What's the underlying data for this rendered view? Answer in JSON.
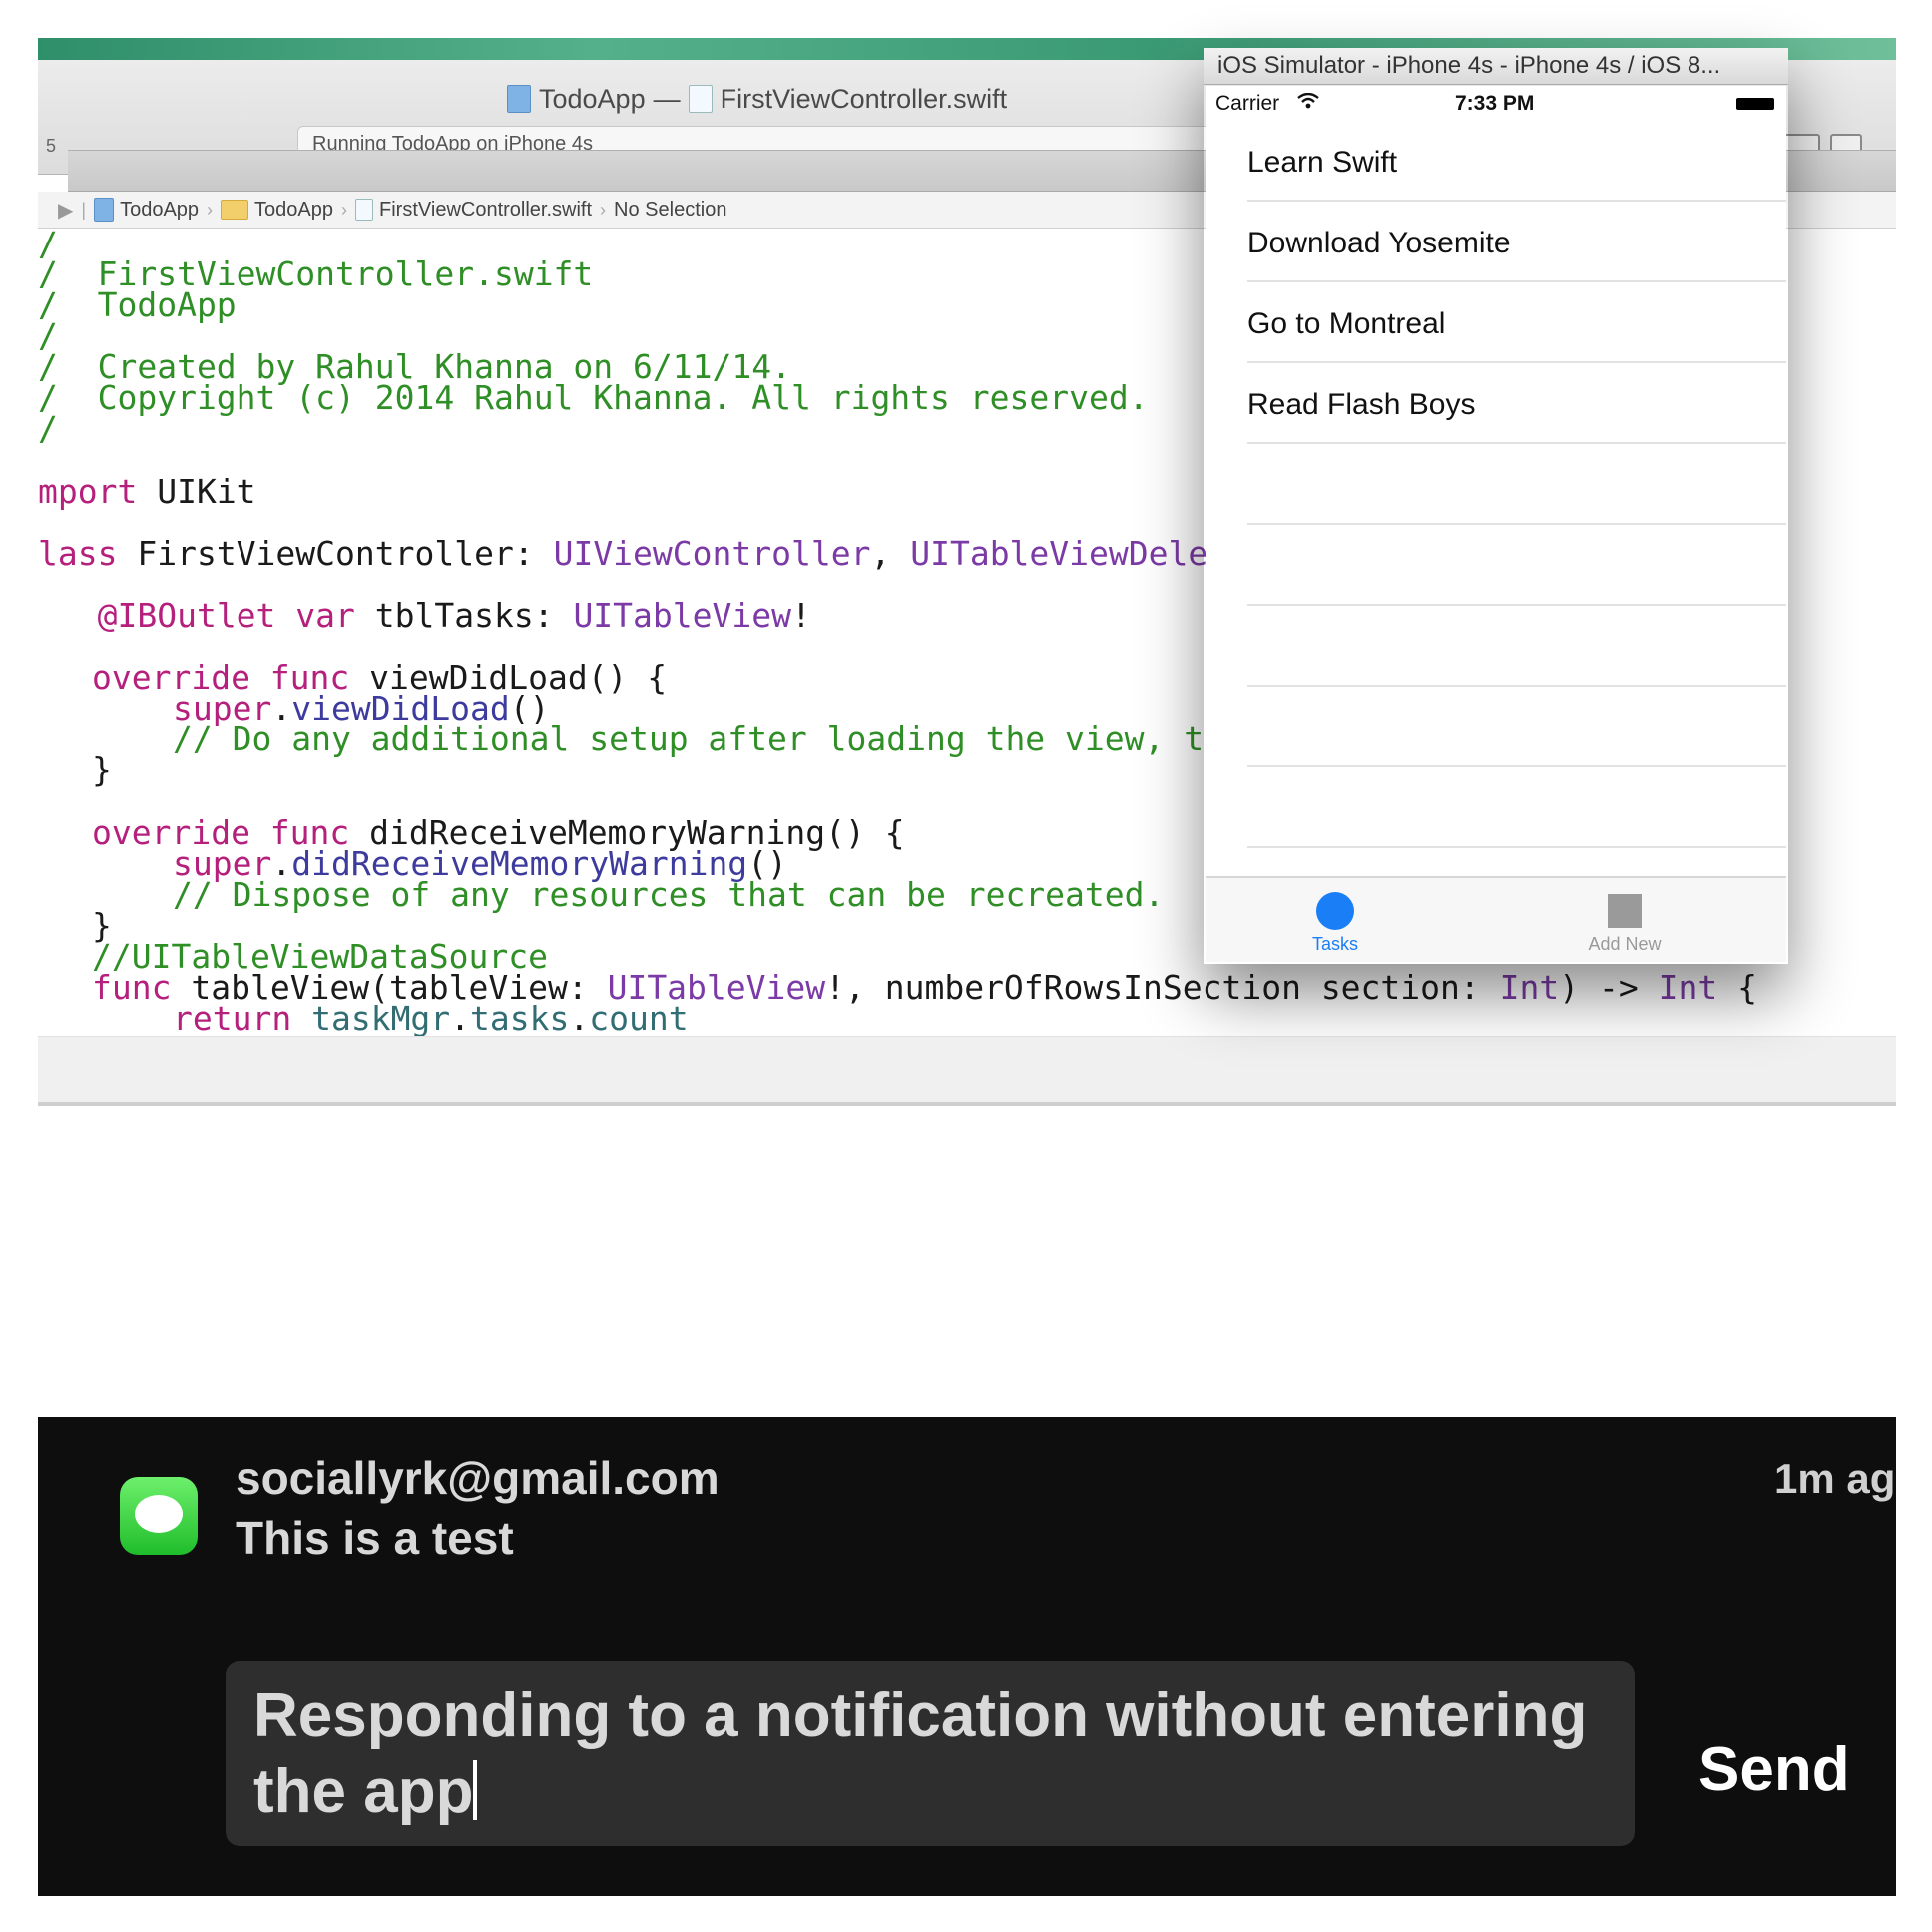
{
  "xcode": {
    "title_project": "TodoApp",
    "title_separator": "—",
    "title_file": "FirstViewController.swift",
    "status": "Running TodoApp on iPhone 4s",
    "toolbar_number": "5",
    "jumpbar": {
      "items": [
        "TodoApp",
        "TodoApp",
        "FirstViewController.swift",
        "No Selection"
      ]
    },
    "code": {
      "l1": "/",
      "l2": "/  FirstViewController.swift",
      "l3": "/  TodoApp",
      "l4": "/",
      "l5": "/  Created by Rahul Khanna on 6/11/14.",
      "l6": "/  Copyright (c) 2014 Rahul Khanna. All rights reserved.",
      "l7": "/",
      "l8_kw": "mport",
      "l8_rest": " UIKit",
      "l9_kw": "lass",
      "l9_mid": " FirstViewController: ",
      "l9_t1": "UIViewController",
      "l9_comma": ", ",
      "l9_t2": "UITableViewDele",
      "l10_indent": "   ",
      "l10_kw": "@IBOutlet var",
      "l10_mid": " tblTasks: ",
      "l10_t": "UITableView",
      "l10_end": "!",
      "l11_kw": "override func",
      "l11_rest": " viewDidLoad() {",
      "l12_kw": "super",
      "l12_dot": ".",
      "l12_fn": "viewDidLoad",
      "l12_end": "()",
      "l13": "// Do any additional setup after loading the view, t",
      "l14": "}",
      "l15_kw": "override func",
      "l15_rest": " didReceiveMemoryWarning() {",
      "l16_kw": "super",
      "l16_dot": ".",
      "l16_fn": "didReceiveMemoryWarning",
      "l16_end": "()",
      "l17": "// Dispose of any resources that can be recreated.",
      "l18": "}",
      "l19": "//UITableViewDataSource",
      "l20_kw": "func",
      "l20_a": " tableView(tableView: ",
      "l20_t1": "UITableView",
      "l20_b": "!, numberOfRowsInSection section: ",
      "l20_t2": "Int",
      "l20_c": ") -> ",
      "l20_t3": "Int",
      "l20_d": " {",
      "l21_kw": "return",
      "l21_sp": " ",
      "l21_p1": "taskMgr",
      "l21_dot1": ".",
      "l21_p2": "tasks",
      "l21_dot2": ".",
      "l21_p3": "count"
    }
  },
  "simulator": {
    "title": "iOS Simulator - iPhone 4s - iPhone 4s / iOS 8...",
    "status": {
      "carrier": "Carrier",
      "wifi_icon": "wifi-icon",
      "time": "7:33 PM"
    },
    "tasks": [
      "Learn Swift",
      "Download Yosemite",
      "Go to Montreal",
      "Read Flash Boys"
    ],
    "tabs": {
      "tasks": "Tasks",
      "add_new": "Add New"
    },
    "accent": "#1a7ef7"
  },
  "notification": {
    "sender": "sociallyrk@gmail.com",
    "message": "This is a test",
    "time": "1m ag",
    "reply_text": "Responding to a notification without entering the app",
    "send_label": "Send",
    "app_icon": "messages-icon",
    "icon_color": "#2fd43a"
  }
}
